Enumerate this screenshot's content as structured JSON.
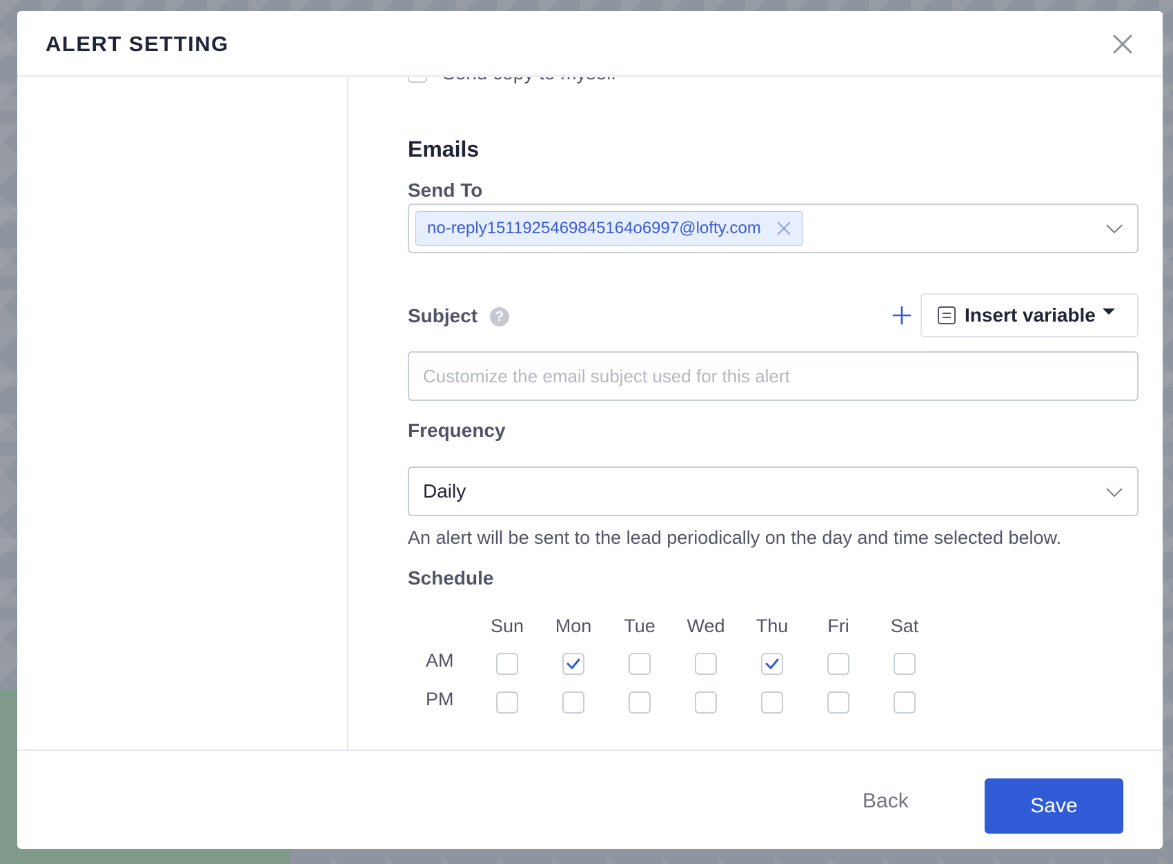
{
  "modal": {
    "title": "ALERT SETTING"
  },
  "copy_to_self": {
    "label": "Send copy to myself",
    "checked": false
  },
  "emails": {
    "section_title": "Emails",
    "send_to_label": "Send To",
    "recipients": [
      "no-reply1511925469845164o6997@lofty.com"
    ]
  },
  "subject": {
    "label": "Subject",
    "help": "?",
    "insert_variable_label": "Insert variable",
    "placeholder": "Customize the email subject used for this alert",
    "value": ""
  },
  "frequency": {
    "label": "Frequency",
    "value": "Daily",
    "helper": "An alert will be sent to the lead periodically on the day and time selected below."
  },
  "schedule": {
    "label": "Schedule",
    "days": [
      "Sun",
      "Mon",
      "Tue",
      "Wed",
      "Thu",
      "Fri",
      "Sat"
    ],
    "rows": [
      {
        "label": "AM",
        "checked": [
          false,
          true,
          false,
          false,
          true,
          false,
          false
        ]
      },
      {
        "label": "PM",
        "checked": [
          false,
          false,
          false,
          false,
          false,
          false,
          false
        ]
      }
    ]
  },
  "footer": {
    "back_label": "Back",
    "save_label": "Save"
  },
  "colors": {
    "accent": "#2f5bd7",
    "tag_bg": "#e8effc",
    "text": "#202437"
  },
  "icons": [
    "close-icon",
    "tag-remove-icon",
    "chevron-down-icon",
    "help-icon",
    "plus-icon",
    "document-icon",
    "caret-down-icon",
    "checkmark-icon"
  ]
}
